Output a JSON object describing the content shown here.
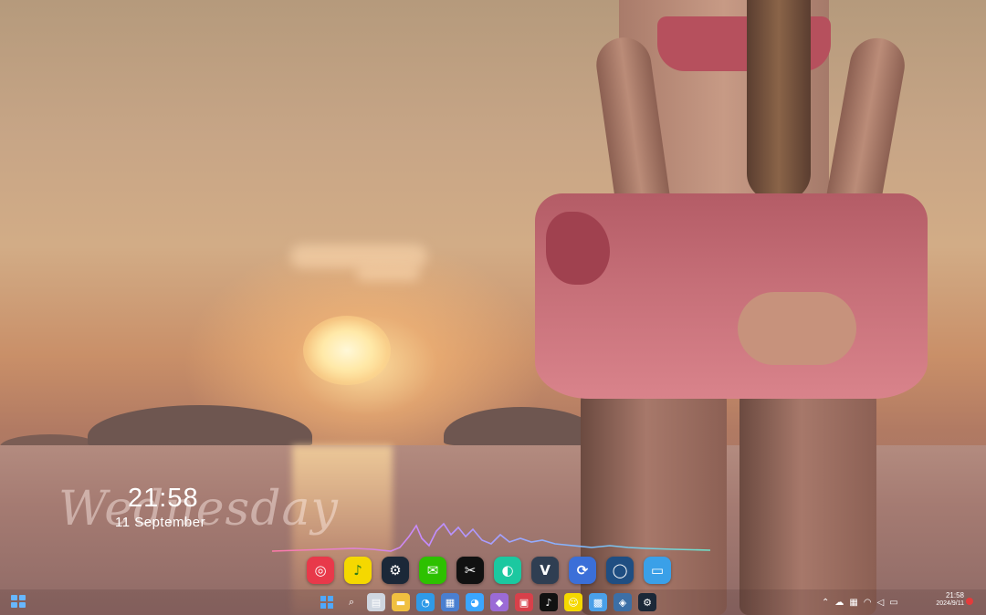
{
  "widget": {
    "day_script": "Wednesday",
    "time": "21:58",
    "date": "11 September"
  },
  "visualizer": {
    "colors": [
      "#ff7aa8",
      "#c58bff",
      "#7fb8ff",
      "#6fe2c8"
    ]
  },
  "dock": {
    "apps": [
      {
        "name": "NetEase Cloud Music",
        "icon": "netease-music-icon",
        "glyph": "◎",
        "bg": "#e8394a"
      },
      {
        "name": "QQ Music",
        "icon": "qq-music-icon",
        "glyph": "♪",
        "bg": "#f5d800"
      },
      {
        "name": "Steam",
        "icon": "steam-icon",
        "glyph": "⚙",
        "bg": "#1b2838"
      },
      {
        "name": "WeChat",
        "icon": "wechat-icon",
        "glyph": "✉",
        "bg": "#2dc100"
      },
      {
        "name": "CapCut",
        "icon": "capcut-icon",
        "glyph": "✂",
        "bg": "#111111"
      },
      {
        "name": "Wallpaper app",
        "icon": "wallpaper-icon",
        "glyph": "◐",
        "bg": "#1bc8a0"
      },
      {
        "name": "Vysor",
        "icon": "vysor-icon",
        "glyph": "V",
        "bg": "#2f3e52"
      },
      {
        "name": "Screen share",
        "icon": "screen-share-icon",
        "glyph": "⟳",
        "bg": "#3b6fd8"
      },
      {
        "name": "Uplay",
        "icon": "uplay-icon",
        "glyph": "◯",
        "bg": "#1f4e82"
      },
      {
        "name": "This PC",
        "icon": "monitor-icon",
        "glyph": "▭",
        "bg": "#3aa0e8"
      }
    ]
  },
  "taskbar": {
    "items": [
      {
        "icon": "windows-start-icon",
        "glyph": ""
      },
      {
        "icon": "search-icon",
        "glyph": "⌕"
      },
      {
        "icon": "task-view-icon",
        "glyph": "▤"
      },
      {
        "icon": "file-explorer-icon",
        "glyph": "▬"
      },
      {
        "icon": "edge-icon",
        "glyph": "◔"
      },
      {
        "icon": "store-icon",
        "glyph": "▦"
      },
      {
        "icon": "browser-icon",
        "glyph": "◕"
      },
      {
        "icon": "game-icon",
        "glyph": "◆"
      },
      {
        "icon": "video-app-icon",
        "glyph": "▣"
      },
      {
        "icon": "tiktok-icon",
        "glyph": "♪"
      },
      {
        "icon": "qq-icon",
        "glyph": "☺"
      },
      {
        "icon": "control-panel-icon",
        "glyph": "▩"
      },
      {
        "icon": "vpn-icon",
        "glyph": "◈"
      },
      {
        "icon": "steam-taskbar-icon",
        "glyph": "⚙"
      }
    ]
  },
  "tray": {
    "time": "21:58",
    "date": "2024/9/11",
    "icons": [
      "chevron-up-icon",
      "onedrive-icon",
      "network-icon",
      "wifi-icon",
      "volume-icon",
      "battery-icon"
    ]
  }
}
